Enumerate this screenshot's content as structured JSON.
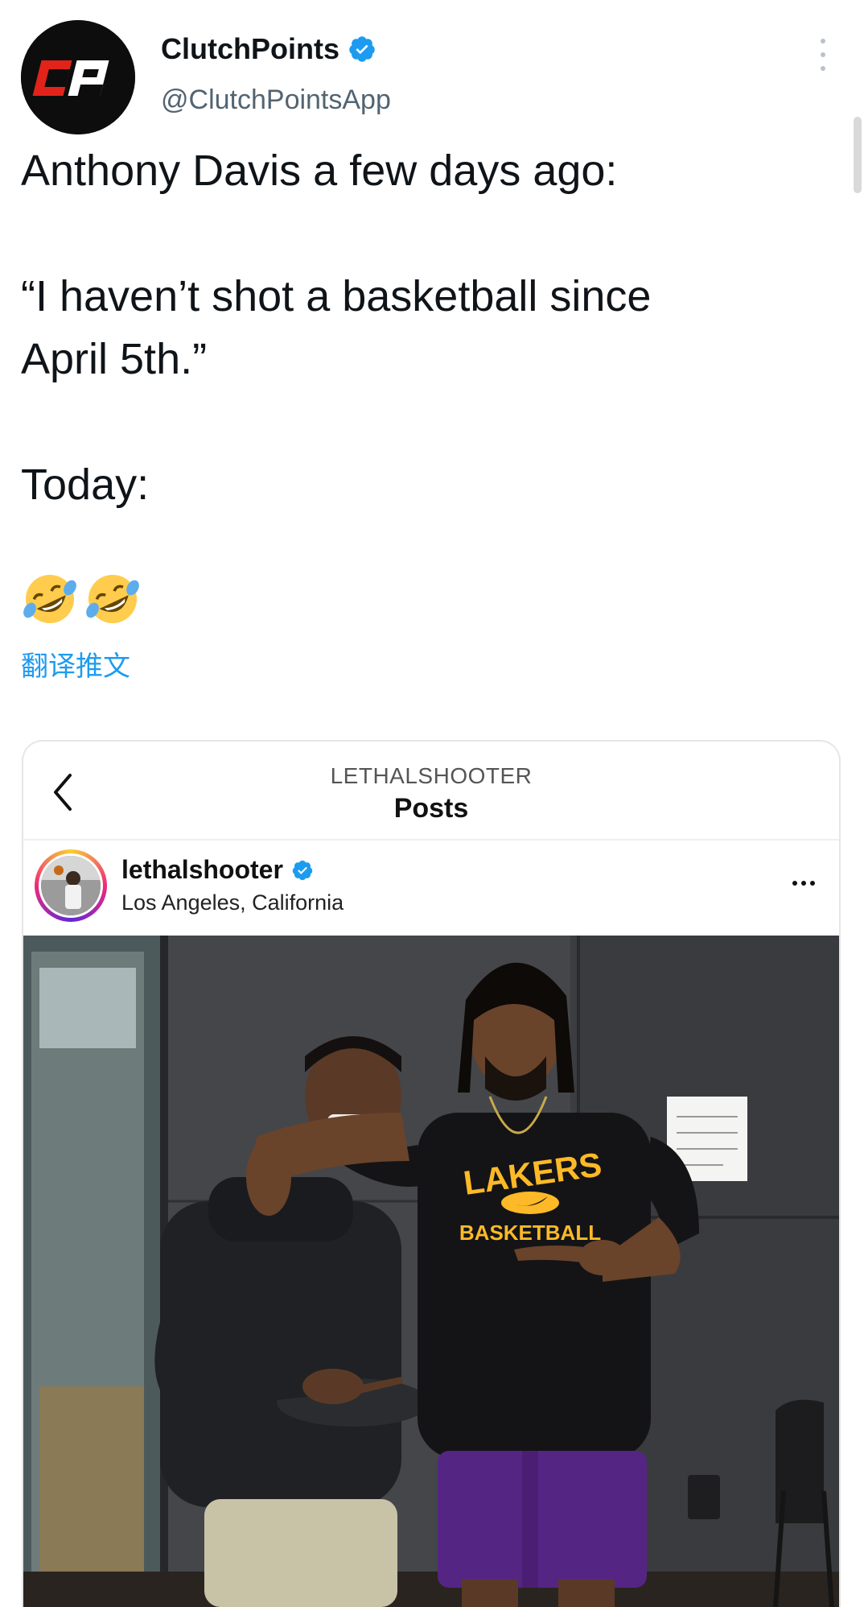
{
  "tweet": {
    "display_name": "ClutchPoints",
    "handle": "@ClutchPointsApp",
    "avatar_text": "CP",
    "verified_icon": "verified-badge-icon",
    "more_icon": "more-vertical-icon",
    "text_lines": [
      "Anthony Davis a few days ago:",
      "“I haven’t shot a basketball since",
      "April 5th.”",
      "Today:"
    ],
    "emojis": [
      "rolling-on-floor-laughing-emoji",
      "rolling-on-floor-laughing-emoji"
    ],
    "translate_label": "翻译推文"
  },
  "embed": {
    "back_icon": "chevron-left-icon",
    "header_username": "LETHALSHOOTER",
    "header_title": "Posts",
    "post_username": "lethalshooter",
    "post_location": "Los Angeles, California",
    "photo_jersey_text": "LAKERS",
    "photo_jersey_subtext": "BASKETBALL"
  },
  "colors": {
    "link_blue": "#1d9bf0",
    "verified_blue": "#1d9bf0",
    "handle_gray": "#536471",
    "lakers_purple": "#552583",
    "lakers_gold": "#fdb927"
  }
}
